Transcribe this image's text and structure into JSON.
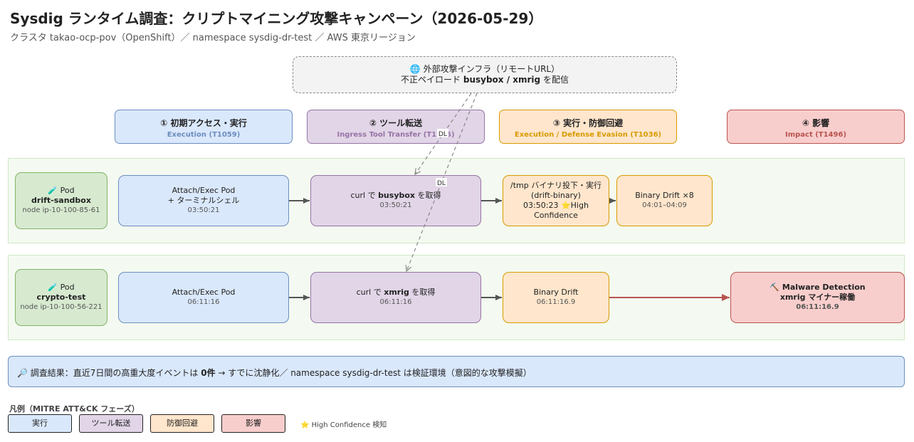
{
  "header": {
    "title": "Sysdig ランタイム調査：クリプトマイニング攻撃キャンペーン（2026-05-29）",
    "subtitle": "クラスタ takao-ocp-pov（OpenShift）／ namespace sysdig-dr-test ／ AWS 東京リージョン"
  },
  "external": {
    "line1": "🌐 外部攻撃インフラ（リモートURL）",
    "line2_pre": "不正ペイロード ",
    "line2_bold": "busybox / xmrig",
    "line2_post": " を配信"
  },
  "phases": [
    {
      "title": "① 初期アクセス・実行",
      "technique": "Execution (T1059)",
      "color": "#6c8ebf"
    },
    {
      "title": "② ツール転送",
      "technique": "Ingress Tool Transfer (T1105)",
      "color": "#9673a6"
    },
    {
      "title": "③ 実行・防御回避",
      "technique": "Execution / Defense Evasion (T1036)",
      "color": "#d79b00"
    },
    {
      "title": "④ 影響",
      "technique": "Impact (T1496)",
      "color": "#b85450"
    }
  ],
  "lane1": {
    "pod": {
      "label": "🧪 Pod",
      "name": "drift-sandbox",
      "node": "node ip-10-100-85-61"
    },
    "exec": {
      "line1": "Attach/Exec Pod",
      "line2": "+ ターミナルシェル",
      "time": "03:50:21"
    },
    "transfer": {
      "pre": "curl で ",
      "bold": "busybox",
      "post": " を取得",
      "time": "03:50:21"
    },
    "drop": {
      "line1": "/tmp バイナリ投下・実行",
      "line2": "(drift-binary)",
      "line3": "03:50:23 ⭐High Confidence"
    },
    "drift": {
      "line1": "Binary Drift ×8",
      "time": "04:01–04:09"
    }
  },
  "lane2": {
    "pod": {
      "label": "🧪 Pod",
      "name": "crypto-test",
      "node": "node ip-10-100-56-221"
    },
    "exec": {
      "line1": "Attach/Exec Pod",
      "time": "06:11:16"
    },
    "transfer": {
      "pre": "curl で ",
      "bold": "xmrig",
      "post": " を取得",
      "time": "06:11:16"
    },
    "drift": {
      "line1": "Binary Drift",
      "time": "06:11:16.9"
    },
    "malware": {
      "line1": "⛏️ Malware Detection",
      "line2": "xmrig マイナー稼働",
      "time": "06:11:16.9"
    }
  },
  "edge_labels": {
    "dl1": "DL",
    "dl2": "DL"
  },
  "summary": {
    "pre": "🔎 調査結果：直近7日間の高重大度イベントは ",
    "bold": "0件",
    "post": " → すでに沈静化／ namespace sysdig-dr-test は検証環境（意図的な攻撃模擬）"
  },
  "legend": {
    "title": "凡例（MITRE ATT&CK フェーズ）",
    "items": [
      "実行",
      "ツール転送",
      "防御回避",
      "影響"
    ],
    "star": "⭐ High Confidence 検知"
  }
}
